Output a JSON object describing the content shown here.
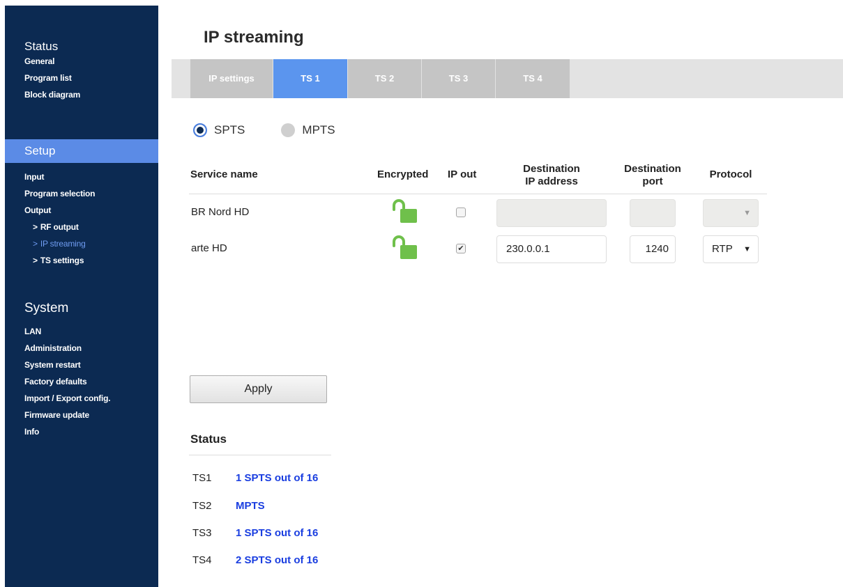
{
  "sidebar": {
    "status": {
      "heading": "Status",
      "items": [
        "General",
        "Program list",
        "Block diagram"
      ]
    },
    "setup": {
      "heading": "Setup",
      "items": [
        "Input",
        "Program selection",
        "Output"
      ],
      "subitems": [
        "RF output",
        "IP streaming",
        "TS settings"
      ],
      "arrow": ">"
    },
    "system": {
      "heading": "System",
      "items": [
        "LAN",
        "Administration",
        "System restart",
        "Factory defaults",
        "Import / Export config.",
        "Firmware update",
        "Info"
      ]
    }
  },
  "page": {
    "title": "IP streaming",
    "tabs": [
      "IP settings",
      "TS 1",
      "TS 2",
      "TS 3",
      "TS 4"
    ],
    "active_tab": "TS 1"
  },
  "mode": {
    "options": [
      "SPTS",
      "MPTS"
    ],
    "selected": "SPTS"
  },
  "table": {
    "headers": {
      "service": "Service name",
      "encrypted": "Encrypted",
      "ip_out": "IP out",
      "dest_ip_1": "Destination",
      "dest_ip_2": "IP address",
      "dest_port_1": "Destination",
      "dest_port_2": "port",
      "protocol": "Protocol"
    },
    "rows": [
      {
        "service": "BR Nord HD",
        "encrypted_icon": "unlocked-icon",
        "ip_out": false,
        "dest_ip": "",
        "dest_port": "",
        "protocol": "",
        "disabled": true
      },
      {
        "service": "arte HD",
        "encrypted_icon": "unlocked-icon",
        "ip_out": true,
        "dest_ip": "230.0.0.1",
        "dest_port": "1240",
        "protocol": "RTP",
        "disabled": false
      }
    ]
  },
  "apply_label": "Apply",
  "status": {
    "title": "Status",
    "rows": [
      {
        "key": "TS1",
        "value": "1 SPTS out of 16"
      },
      {
        "key": "TS2",
        "value": "MPTS"
      },
      {
        "key": "TS3",
        "value": "1 SPTS out of 16"
      },
      {
        "key": "TS4",
        "value": "2 SPTS out of 16"
      }
    ]
  },
  "colors": {
    "sidebar_bg": "#0c2a52",
    "accent": "#5b95ee",
    "lock_green": "#6fc04b",
    "status_value": "#1a3ee0"
  }
}
